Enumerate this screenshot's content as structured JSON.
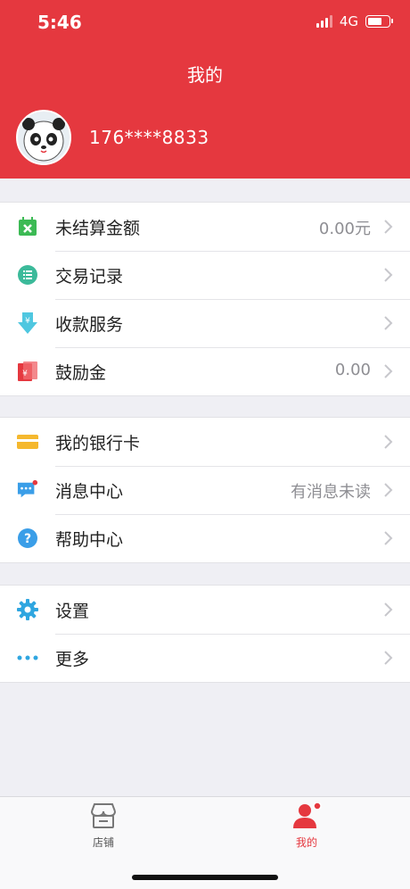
{
  "status_bar": {
    "time": "5:46",
    "network": "4G"
  },
  "header": {
    "title": "我的",
    "phone": "176****8833"
  },
  "groups": [
    {
      "items": [
        {
          "label": "未结算金额",
          "value": "0.00元",
          "icon": "calendar-x-icon",
          "color": "#3cba54"
        },
        {
          "label": "交易记录",
          "value": "",
          "icon": "list-icon",
          "color": "#3cba9a"
        },
        {
          "label": "收款服务",
          "value": "",
          "icon": "yuan-download-icon",
          "color": "#4fc7e0"
        },
        {
          "label": "鼓励金",
          "value": "0.00",
          "icon": "red-envelope-icon",
          "color": "#e5383f"
        }
      ]
    },
    {
      "items": [
        {
          "label": "我的银行卡",
          "value": "",
          "icon": "bank-card-icon",
          "color": "#f5b82e"
        },
        {
          "label": "消息中心",
          "value": "有消息未读",
          "icon": "message-icon",
          "color": "#3a9ee8"
        },
        {
          "label": "帮助中心",
          "value": "",
          "icon": "help-icon",
          "color": "#3a9ee8"
        }
      ]
    },
    {
      "items": [
        {
          "label": "设置",
          "value": "",
          "icon": "gear-icon",
          "color": "#2fa6e0"
        },
        {
          "label": "更多",
          "value": "",
          "icon": "more-dots-icon",
          "color": "#2fa6e0"
        }
      ]
    }
  ],
  "tabbar": {
    "tabs": [
      {
        "label": "店铺",
        "icon": "store-icon",
        "active": false
      },
      {
        "label": "我的",
        "icon": "person-icon",
        "active": true
      }
    ]
  },
  "colors": {
    "brand": "#e5383f",
    "background": "#efeff4",
    "muted": "#8e8e93"
  }
}
